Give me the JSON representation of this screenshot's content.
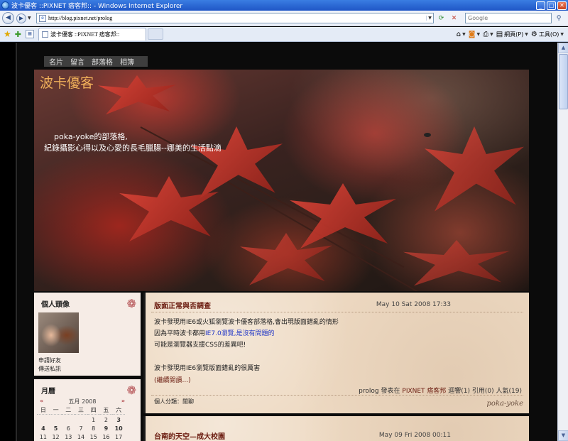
{
  "window": {
    "title": "波卡優客 ::PIXNET 痞客邦:: - Windows Internet Explorer",
    "buttons": {
      "minimize": "_",
      "maximize": "□",
      "close": "✕"
    }
  },
  "address": {
    "url": "http://blog.pixnet.net/prolog",
    "search_placeholder": "Google"
  },
  "tabs": [
    {
      "label": "波卡優客 ::PIXNET 痞客邦::"
    }
  ],
  "commands": {
    "page": "網頁(P)",
    "tools": "工具(O)"
  },
  "blog": {
    "nav": [
      "名片",
      "留言",
      "部落格",
      "相簿"
    ],
    "title": "波卡優客",
    "desc_line1": "poka-yoke的部落格,",
    "desc_line2": "紀錄攝影心得以及心愛的長毛臘腸--娜美的生活點滴"
  },
  "sidebar": {
    "profile": {
      "heading": "個人頭像",
      "links": [
        "申請好友",
        "傳送私訊"
      ]
    },
    "calendar": {
      "heading": "月曆",
      "prev": "«",
      "month": "五月 2008",
      "next": "»",
      "weekdays": [
        "日",
        "一",
        "二",
        "三",
        "四",
        "五",
        "六"
      ],
      "days": [
        "",
        "",
        "",
        "",
        "1",
        "2",
        "3",
        "4",
        "5",
        "6",
        "7",
        "8",
        "9",
        "10",
        "11",
        "12",
        "13",
        "14",
        "15",
        "16",
        "17"
      ]
    }
  },
  "posts": [
    {
      "title": "版面正常與否調查",
      "date": "May 10 Sat 2008 17:33",
      "line1": "波卡發現用IE6或火狐瀏覽波卡優客部落格,會出現版面錯亂的情形",
      "line2_pre": "因為平時波卡都用",
      "line2_link": "IE7.0瀏覽,是沒有問題的",
      "line3": "可能是瀏覽器支援CSS的差異吧!",
      "line4": "波卡發現用IE6瀏覽版面錯亂的很厲害",
      "more": "(繼續閱讀...)",
      "meta_author": "prolog",
      "meta_posted": "發表在",
      "meta_site": "PIXNET 痞客邦",
      "meta_rest": "迴響(1) 引用(0) 人氣(19)",
      "category": "個人分類：閒聊",
      "signature": "poka-yoke"
    },
    {
      "title": "台南的天空—成大校園",
      "date": "May 09 Fri 2008 00:11"
    }
  ]
}
